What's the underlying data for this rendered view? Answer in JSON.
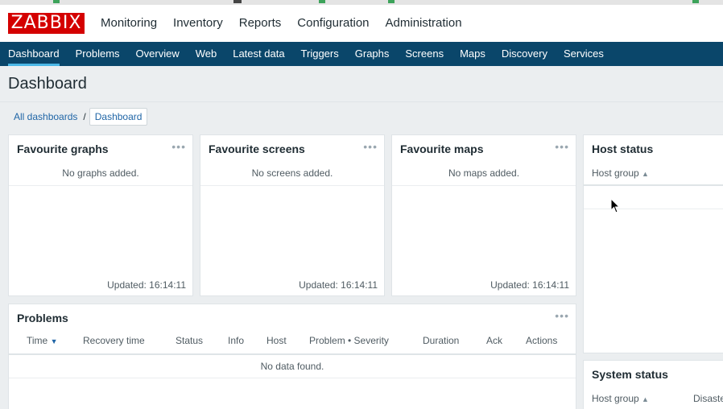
{
  "brand": {
    "logo_text": "ZABBIX",
    "logo_color": "#d40000"
  },
  "main_menu": [
    {
      "label": "Monitoring"
    },
    {
      "label": "Inventory"
    },
    {
      "label": "Reports"
    },
    {
      "label": "Configuration"
    },
    {
      "label": "Administration"
    }
  ],
  "sub_menu": [
    {
      "label": "Dashboard",
      "active": true
    },
    {
      "label": "Problems"
    },
    {
      "label": "Overview"
    },
    {
      "label": "Web"
    },
    {
      "label": "Latest data"
    },
    {
      "label": "Triggers"
    },
    {
      "label": "Graphs"
    },
    {
      "label": "Screens"
    },
    {
      "label": "Maps"
    },
    {
      "label": "Discovery"
    },
    {
      "label": "Services"
    }
  ],
  "page": {
    "title": "Dashboard",
    "breadcrumb": {
      "root": "All dashboards",
      "separator": "/",
      "current": "Dashboard"
    }
  },
  "widgets": {
    "favourite_graphs": {
      "title": "Favourite graphs",
      "empty": "No graphs added.",
      "updated": "Updated: 16:14:11",
      "menu": "•••"
    },
    "favourite_screens": {
      "title": "Favourite screens",
      "empty": "No screens added.",
      "updated": "Updated: 16:14:11",
      "menu": "•••"
    },
    "favourite_maps": {
      "title": "Favourite maps",
      "empty": "No maps added.",
      "updated": "Updated: 16:14:11",
      "menu": "•••"
    },
    "host_status": {
      "title": "Host status",
      "column": "Host group",
      "sort_icon": "▲"
    },
    "problems": {
      "title": "Problems",
      "menu": "•••",
      "columns": [
        "Time",
        "Recovery time",
        "Status",
        "Info",
        "Host",
        "Problem • Severity",
        "Duration",
        "Ack",
        "Actions"
      ],
      "sort_icon": "▼",
      "empty": "No data found."
    },
    "system_status": {
      "title": "System status",
      "columns": [
        "Host group",
        "Disaste"
      ],
      "sort_icon": "▲"
    }
  },
  "colors": {
    "nav_bar": "#0a466a",
    "active_underline": "#4bb7e6",
    "link": "#1f65a6",
    "background": "#ebeef0"
  }
}
